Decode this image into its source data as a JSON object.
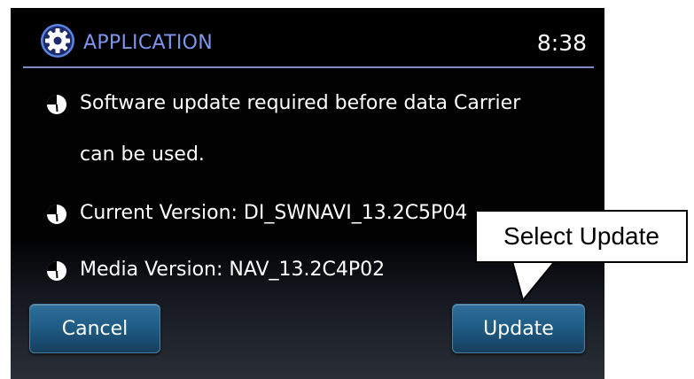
{
  "header": {
    "icon": "gear-icon",
    "title": "APPLICATION",
    "clock": "8:38",
    "accent_color": "#7d95ea"
  },
  "messages": [
    {
      "icon": "clock-bullet-icon",
      "text": "Software update required before data Carrier"
    },
    {
      "icon": "",
      "text": "can be used."
    },
    {
      "icon": "clock-bullet-icon",
      "text": "Current Version: DI_SWNAVI_13.2C5P04"
    },
    {
      "icon": "clock-bullet-icon",
      "text": "Media Version: NAV_13.2C4P02"
    }
  ],
  "buttons": {
    "cancel_label": "Cancel",
    "update_label": "Update",
    "color": "#1f5d86"
  },
  "callout": {
    "text": "Select Update"
  }
}
